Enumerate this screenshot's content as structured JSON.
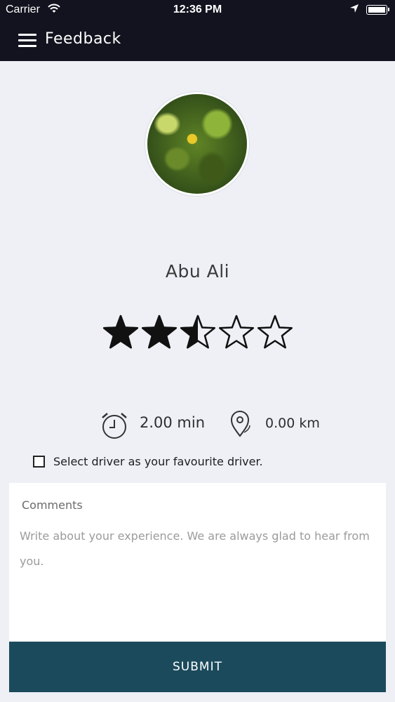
{
  "status_bar": {
    "carrier": "Carrier",
    "time": "12:36 PM"
  },
  "header": {
    "title": "Feedback",
    "menu_icon": "hamburger-menu-icon"
  },
  "driver": {
    "name": "Abu Ali",
    "avatar": "leaves-photo",
    "rating": 2.5,
    "rating_max": 5
  },
  "stats": {
    "time_value": "2.00 min",
    "time_icon": "alarm-clock-icon",
    "distance_value": "0.00 km",
    "distance_icon": "map-pin-icon"
  },
  "favourite": {
    "label": "Select driver as your favourite driver.",
    "checked": false
  },
  "comments": {
    "title": "Comments",
    "placeholder": "Write about your experience. We are always glad to hear from you.",
    "value": ""
  },
  "submit_label": "SUBMIT",
  "colors": {
    "header_bg": "#12131f",
    "page_bg": "#eef0f6",
    "submit_bg": "#1b4a5c",
    "star_fill": "#111111"
  }
}
